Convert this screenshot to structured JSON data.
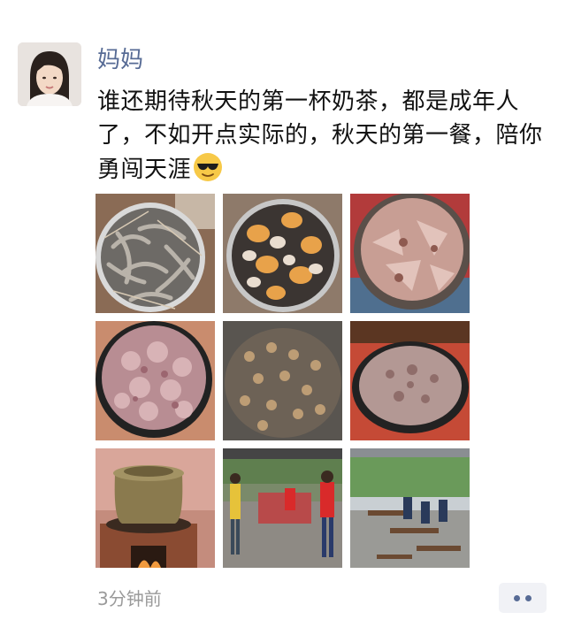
{
  "post": {
    "author": "妈妈",
    "text": "谁还期待秋天的第一杯奶茶，都是成年人了，不如开点实际的，秋天的第一餐，陪你勇闯天涯",
    "emoji": "sunglasses-emoji",
    "time": "3分钟前"
  },
  "photos": [
    {
      "name": "shrimp-photo"
    },
    {
      "name": "crabs-photo"
    },
    {
      "name": "raw-meat-bowl-photo"
    },
    {
      "name": "pork-bowl-photo"
    },
    {
      "name": "wok-stir-fry-photo"
    },
    {
      "name": "pan-stew-photo"
    },
    {
      "name": "clay-pot-stove-photo"
    },
    {
      "name": "outdoor-cooking-photo"
    },
    {
      "name": "outdoor-tables-photo"
    }
  ],
  "colors": {
    "link": "#576b95",
    "meta": "#9a9a9a"
  }
}
